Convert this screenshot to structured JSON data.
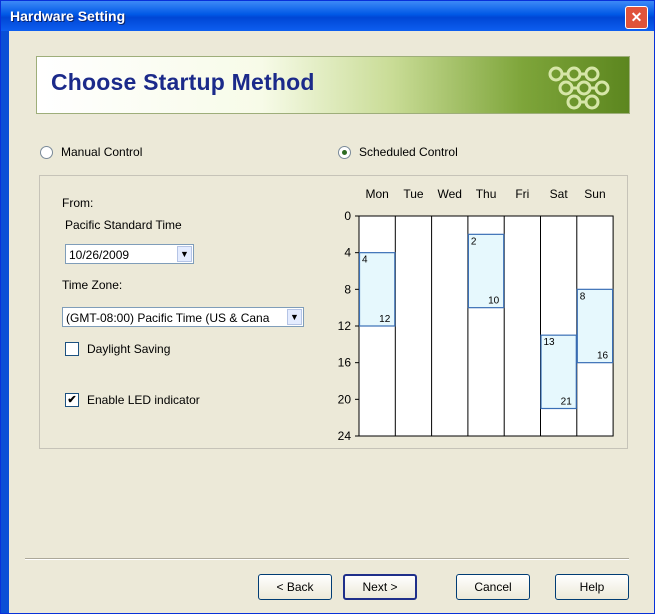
{
  "window": {
    "title": "Hardware Setting",
    "close_label": "✕"
  },
  "banner": {
    "title": "Choose Startup Method"
  },
  "startup": {
    "manual_label": "Manual Control",
    "scheduled_label": "Scheduled Control",
    "selected": "scheduled"
  },
  "settings": {
    "from_label": "From:",
    "timezone_name": "Pacific Standard Time",
    "date_value": "10/26/2009",
    "timezone_label": "Time Zone:",
    "timezone_value": "(GMT-08:00) Pacific Time (US & Cana",
    "daylight_label": "Daylight Saving",
    "daylight_checked": false,
    "led_label": "Enable LED indicator",
    "led_checked": true
  },
  "schedule": {
    "days": [
      "Mon",
      "Tue",
      "Wed",
      "Thu",
      "Fri",
      "Sat",
      "Sun"
    ],
    "hour_ticks": [
      0,
      4,
      8,
      12,
      16,
      20,
      24
    ],
    "blocks": [
      {
        "day": "Mon",
        "start": 4,
        "end": 12
      },
      {
        "day": "Thu",
        "start": 2,
        "end": 10
      },
      {
        "day": "Sat",
        "start": 13,
        "end": 21
      },
      {
        "day": "Sun",
        "start": 8,
        "end": 16
      }
    ],
    "block_color": "#e6f8fd",
    "block_border": "#3a6fb6"
  },
  "buttons": {
    "back": "< Back",
    "next": "Next >",
    "cancel": "Cancel",
    "help": "Help"
  }
}
